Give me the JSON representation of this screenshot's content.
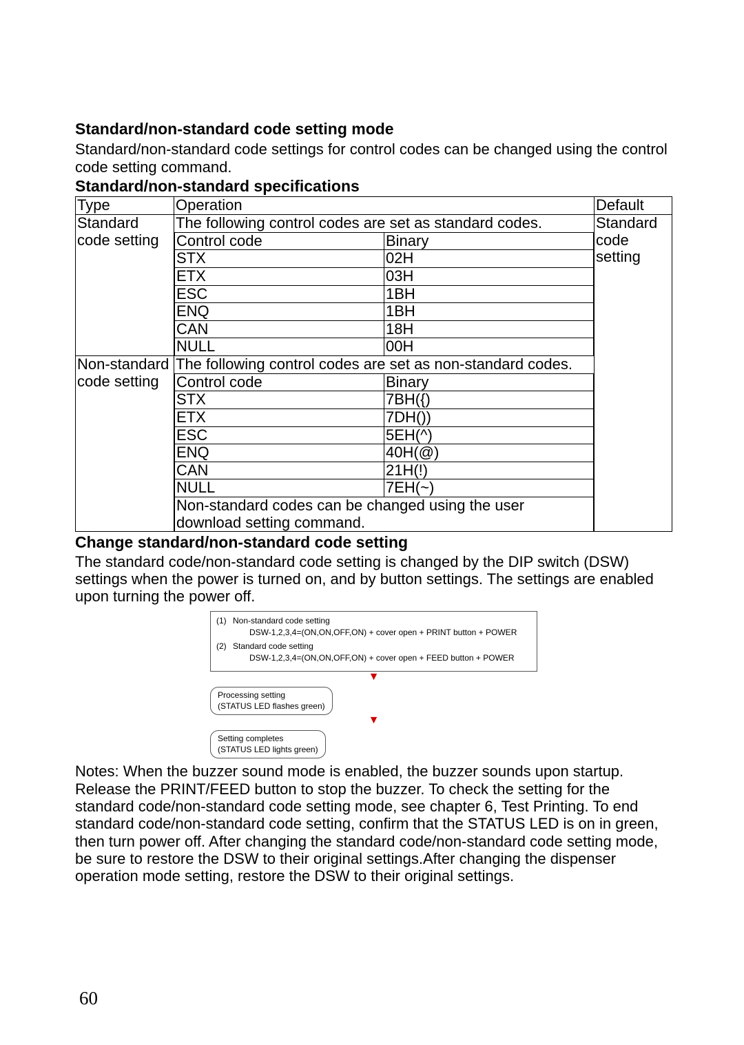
{
  "heading1": "Standard/non-standard code setting mode",
  "intro": "Standard/non-standard code settings for control codes can be changed using the control code setting command.",
  "heading2": "Standard/non-standard specifications",
  "table": {
    "headers": [
      "Type",
      "Operation",
      "Default"
    ],
    "rows": [
      {
        "type": "Standard code setting",
        "op_intro": "The following control codes are set as standard codes.",
        "sub_header": [
          "Control code",
          "Binary"
        ],
        "sub_rows": [
          [
            "STX",
            "02H"
          ],
          [
            "ETX",
            "03H"
          ],
          [
            "ESC",
            "1BH"
          ],
          [
            "ENQ",
            "1BH"
          ],
          [
            "CAN",
            "18H"
          ],
          [
            "NULL",
            "00H"
          ]
        ],
        "default": "Standard code setting"
      },
      {
        "type": "Non-standard code setting",
        "op_intro": "The following control codes are set as non-standard codes.",
        "sub_header": [
          "Control code",
          "Binary"
        ],
        "sub_rows": [
          [
            "STX",
            "7BH({)"
          ],
          [
            "ETX",
            "7DH())"
          ],
          [
            "ESC",
            "5EH(^)"
          ],
          [
            "ENQ",
            "40H(@)"
          ],
          [
            "CAN",
            "21H(!)"
          ],
          [
            "NULL",
            "7EH(~)"
          ]
        ],
        "note": "Non-standard codes can be changed using the user download setting command.",
        "default": ""
      }
    ]
  },
  "heading3": "Change standard/non-standard code setting",
  "para3": "The standard code/non-standard code setting is changed by the DIP switch (DSW) settings when the power is turned on, and by button settings. The settings are enabled upon turning the power off.",
  "figure": {
    "steps": [
      {
        "n": "(1)",
        "title": "Non-standard code setting",
        "detail": "DSW-1,2,3,4=(ON,ON,OFF,ON) + cover open + PRINT button + POWER"
      },
      {
        "n": "(2)",
        "title": "Standard code setting",
        "detail": "DSW-1,2,3,4=(ON,ON,OFF,ON) + cover open + FEED button + POWER"
      }
    ],
    "bubble1": "Processing setting\n(STATUS LED flashes green)",
    "bubble2": "Setting completes\n(STATUS LED lights green)"
  },
  "notes": "Notes: When the buzzer sound mode is enabled, the buzzer sounds upon startup. Release the PRINT/FEED button to stop the buzzer. To check the setting for the standard code/non-standard code setting mode, see chapter 6, Test Printing.  To end standard code/non-standard code setting, confirm that the STATUS LED is on in green, then turn power off. After changing the standard code/non-standard code setting mode, be sure to restore the DSW to their original settings.After changing the dispenser operation mode setting, restore the DSW to their original settings.",
  "page_number": "60"
}
